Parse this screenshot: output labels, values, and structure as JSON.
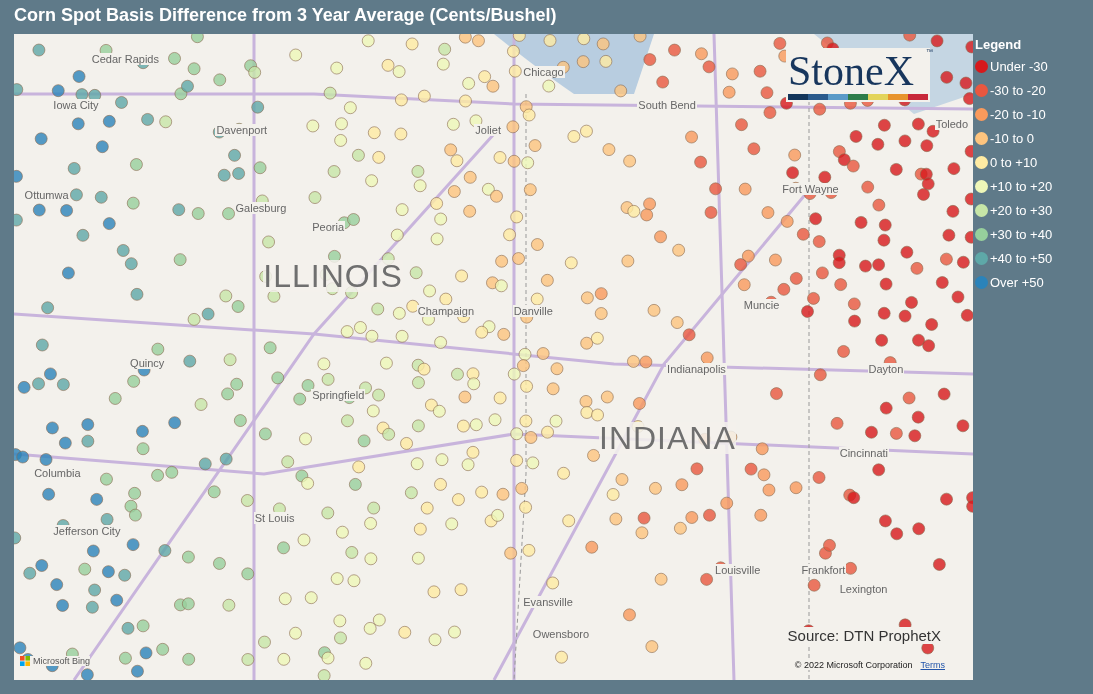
{
  "title": "Corn Spot Basis Difference from 3 Year Average (Cents/Bushel)",
  "logo": {
    "text": "StoneX",
    "mark": "™"
  },
  "map": {
    "states": [
      "ILLINOIS",
      "INDIANA"
    ],
    "cities": [
      "Cedar Rapids",
      "Iowa City",
      "Davenport",
      "Ottumwa",
      "Galesburg",
      "Peoria",
      "Quincy",
      "Springfield",
      "Chicago",
      "Joliet",
      "South Bend",
      "Toledo",
      "Fort Wayne",
      "Muncie",
      "Indianapolis",
      "Dayton",
      "Danville",
      "Cincinnati",
      "St Louis",
      "Columbia",
      "Jefferson City",
      "Louisville",
      "Frankfort",
      "Lexington",
      "Evansville",
      "Owensboro",
      "Champaign"
    ],
    "source": "Source: DTN ProphetX",
    "attribution": "Microsoft Bing",
    "copyright": "© 2022 Microsoft Corporation",
    "terms": "Terms"
  },
  "legend": {
    "title": "Legend",
    "items": [
      {
        "label": "Under -30",
        "color": "#d7191c"
      },
      {
        "label": "-30 to -20",
        "color": "#e9573f"
      },
      {
        "label": "-20 to -10",
        "color": "#f99a5c"
      },
      {
        "label": "-10 to 0",
        "color": "#fdc47e"
      },
      {
        "label": "0 to +10",
        "color": "#feeba3"
      },
      {
        "label": "+10 to +20",
        "color": "#eef7b8"
      },
      {
        "label": "+20 to +30",
        "color": "#c7e6a7"
      },
      {
        "label": "+30 to +40",
        "color": "#97cf9c"
      },
      {
        "label": "+40 to +50",
        "color": "#5ea8a8"
      },
      {
        "label": "Over +50",
        "color": "#2b83ba"
      }
    ]
  }
}
